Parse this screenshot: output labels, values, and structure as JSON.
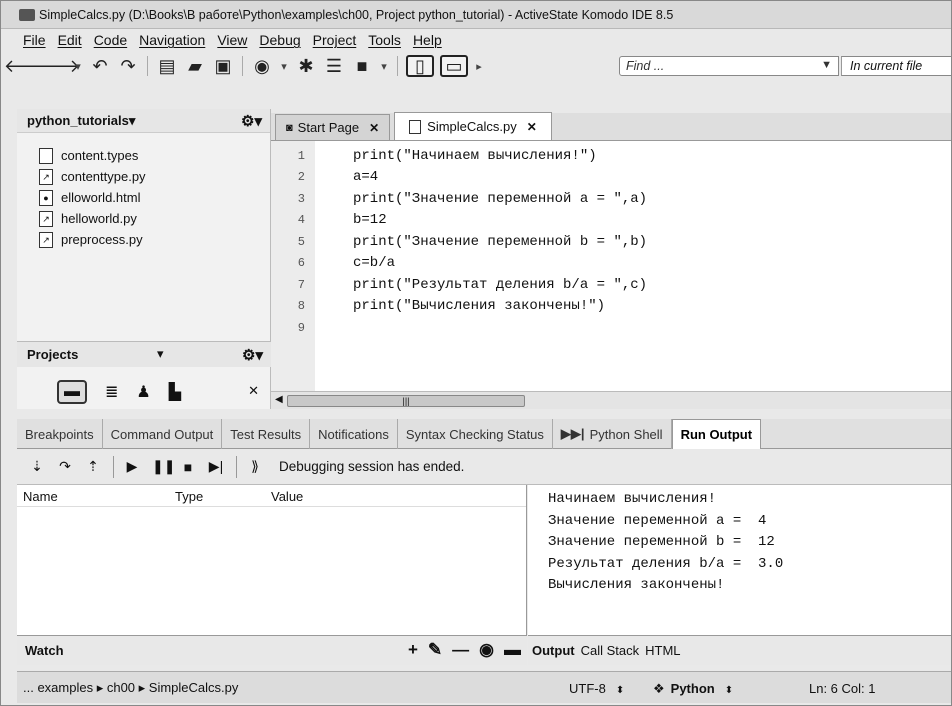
{
  "window": {
    "title": "SimpleCalcs.py (D:\\Books\\В работе\\Python\\examples\\ch00, Project python_tutorial) - ActiveState Komodo IDE 8.5"
  },
  "menu": [
    "File",
    "Edit",
    "Code",
    "Navigation",
    "View",
    "Debug",
    "Project",
    "Tools",
    "Help"
  ],
  "toolbar": {
    "find_placeholder": "Find ...",
    "scope": "In current file"
  },
  "places": {
    "title": "python_tutorials",
    "files": [
      {
        "name": "content.types",
        "icon": "file-icon"
      },
      {
        "name": "contenttype.py",
        "icon": "python-file-icon"
      },
      {
        "name": "elloworld.html",
        "icon": "html-file-icon"
      },
      {
        "name": "helloworld.py",
        "icon": "python-file-icon"
      },
      {
        "name": "preprocess.py",
        "icon": "python-file-icon"
      }
    ],
    "projects_label": "Projects"
  },
  "editor": {
    "tabs": [
      {
        "label": "Start Page",
        "active": false
      },
      {
        "label": "SimpleCalcs.py",
        "active": true
      }
    ],
    "lines": [
      {
        "num": "1",
        "text": "print(\"Начинаем вычисления!\")"
      },
      {
        "num": "2",
        "text": "a=4"
      },
      {
        "num": "3",
        "text": "print(\"Значение переменной a = \",a)"
      },
      {
        "num": "4",
        "text": "b=12"
      },
      {
        "num": "5",
        "text": "print(\"Значение переменной b = \",b)"
      },
      {
        "num": "6",
        "text": "c=b/a"
      },
      {
        "num": "7",
        "text": "print(\"Результат деления b/a = \",c)"
      },
      {
        "num": "8",
        "text": "print(\"Вычисления закончены!\")"
      },
      {
        "num": "9",
        "text": ""
      }
    ]
  },
  "bottom_tabs": [
    {
      "label": "Breakpoints",
      "active": false
    },
    {
      "label": "Command Output",
      "active": false
    },
    {
      "label": "Test Results",
      "active": false
    },
    {
      "label": "Notifications",
      "active": false
    },
    {
      "label": "Syntax Checking Status",
      "active": false
    },
    {
      "label": "Python Shell",
      "active": false
    },
    {
      "label": "Run Output",
      "active": true
    }
  ],
  "debug": {
    "message": "Debugging session has ended."
  },
  "variables": {
    "columns": [
      "Name",
      "Type",
      "Value"
    ]
  },
  "output": {
    "lines": [
      "Начинаем вычисления!",
      "Значение переменной a =  4",
      "Значение переменной b =  12",
      "Результат деления b/a =  3.0",
      "Вычисления закончены!"
    ],
    "tabs": [
      "Output",
      "Call Stack",
      "HTML"
    ]
  },
  "watch": {
    "label": "Watch"
  },
  "statusbar": {
    "path": "... examples ▸ ch00 ▸ SimpleCalcs.py",
    "encoding": "UTF-8",
    "language": "Python",
    "position": "Ln: 6 Col: 1"
  }
}
